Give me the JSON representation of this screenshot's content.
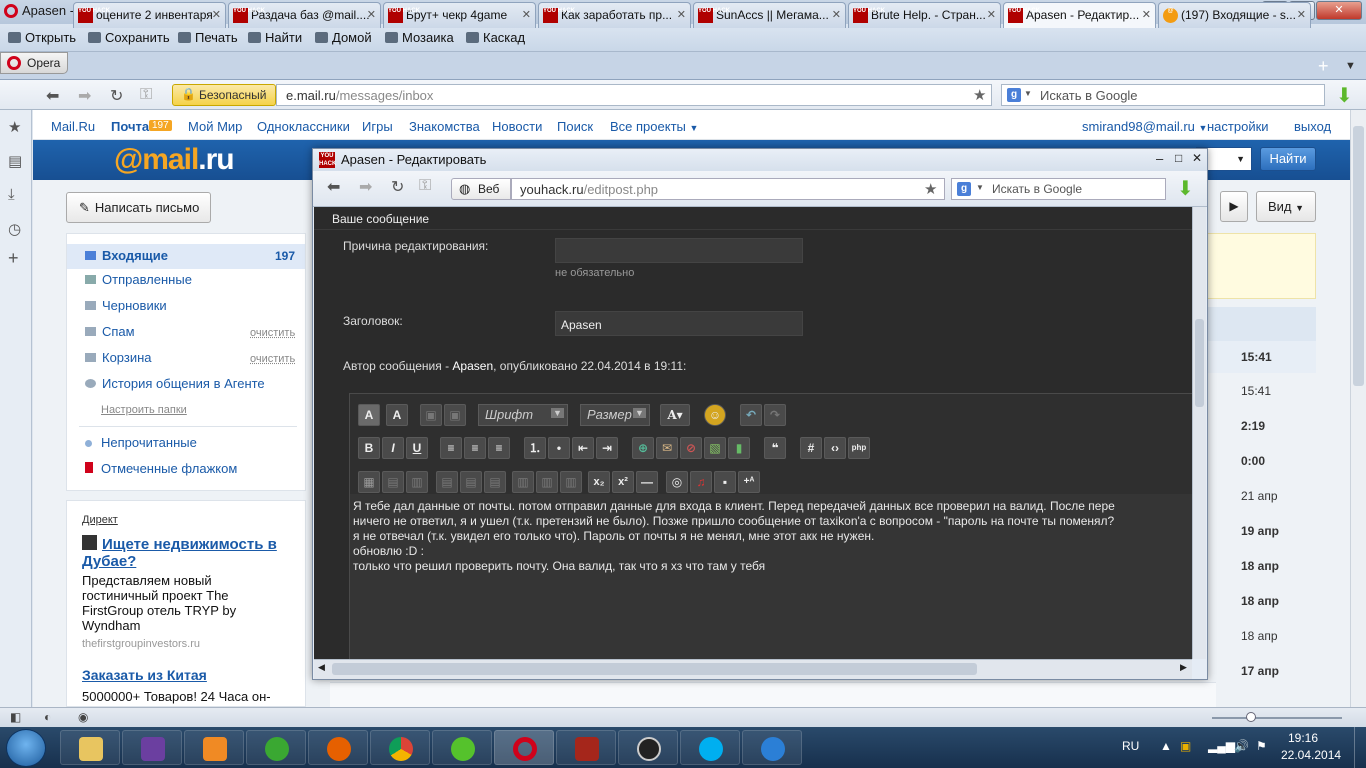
{
  "window": {
    "title": "Apasen - Редактировать - Opera"
  },
  "menu": [
    "Открыть",
    "Сохранить",
    "Печать",
    "Найти",
    "Домой",
    "Мозаика",
    "Каскад"
  ],
  "opera_button": "Opera",
  "tabs": [
    {
      "label": "оцените 2 инвентаря",
      "fav": "YOU HACK"
    },
    {
      "label": "Раздача баз @mail....",
      "fav": "YOU HACK"
    },
    {
      "label": "Брут+ чекр 4game",
      "fav": "YOU HACK"
    },
    {
      "label": "Как заработать пр...",
      "fav": "YOU HACK"
    },
    {
      "label": "SunAccs || Мегама...",
      "fav": "YOU HACK"
    },
    {
      "label": "Brute Help. - Стран...",
      "fav": "YOU HACK"
    },
    {
      "label": "Apasen - Редактир...",
      "fav": "YOU HACK"
    },
    {
      "label": "(197) Входящие - s...",
      "fav": "@"
    }
  ],
  "address": {
    "secure_label": "Безопасный",
    "url_domain": "e.mail.ru",
    "url_path": "/messages/inbox",
    "search_placeholder": "Искать в Google"
  },
  "mail": {
    "toplinks": [
      "Mail.Ru",
      "Почта",
      "Мой Мир",
      "Одноклассники",
      "Игры",
      "Знакомства",
      "Новости",
      "Поиск",
      "Все проекты"
    ],
    "pochta_count": "197",
    "user": "smirand98@mail.ru",
    "settings": "настройки",
    "logout": "выход",
    "logo_at": "@mail",
    "logo_tld": ".ru",
    "find_button": "Найти",
    "compose": "Написать письмо",
    "view_button": "Вид",
    "folders": [
      {
        "label": "Входящие",
        "count": "197"
      },
      {
        "label": "Отправленные"
      },
      {
        "label": "Черновики"
      },
      {
        "label": "Спам",
        "action": "очистить"
      },
      {
        "label": "Корзина",
        "action": "очистить"
      },
      {
        "label": "История общения в Агенте"
      }
    ],
    "configure_folders": "Настроить папки",
    "unread": "Непрочитанные",
    "flagged": "Отмеченные флажком",
    "ads": {
      "header": "Директ",
      "ad1_title": "Ищете недвижимость в Дубае?",
      "ad1_text": "Представляем новый гостиничный проект The FirstGroup отель TRYP by Wyndham",
      "ad1_url": "thefirstgroupinvestors.ru",
      "ad2_title": "Заказать из Китая",
      "ad2_text": "5000000+ Товаров! 24 Часа он-"
    },
    "times": [
      "15:41",
      "15:41",
      "2:19",
      "0:00",
      "21 апр",
      "19 апр",
      "18 апр",
      "18 апр",
      "18 апр",
      "17 апр"
    ]
  },
  "popup": {
    "title": "Apasen - Редактировать",
    "web_label": "Веб",
    "url_domain": "youhack.ru",
    "url_path": "/editpost.php",
    "search_placeholder": "Искать в Google",
    "section": "Ваше сообщение",
    "reason_label": "Причина редактирования:",
    "reason_hint": "не обязательно",
    "subject_label": "Заголовок:",
    "subject_value": "Apasen",
    "author_prefix": "Автор сообщения - ",
    "author_name": "Apasen",
    "author_suffix": ", опубликовано 22.04.2014 в 19:11:",
    "font_select": "Шрифт",
    "size_select": "Размер",
    "message_lines": [
      "Я тебе дал данные от почты. потом отправил данные для входа в клиент. Перед передачей данных все проверил на валид. После пере",
      "ничего не ответил, я и ушел (т.к. претензий не было). Позже пришло сообщение от taxikon'a с вопросом -  \"пароль на почте ты поменял?",
      "я не отвечал (т.к. увидел его только что). Пароль от почты я не менял, мне этот акк не нужен.",
      "обновлю :D :",
      "только что решил проверить почту. Она валид, так что я хз что там у тебя"
    ]
  },
  "taskbar": {
    "lang": "RU",
    "time": "19:16",
    "date": "22.04.2014"
  }
}
